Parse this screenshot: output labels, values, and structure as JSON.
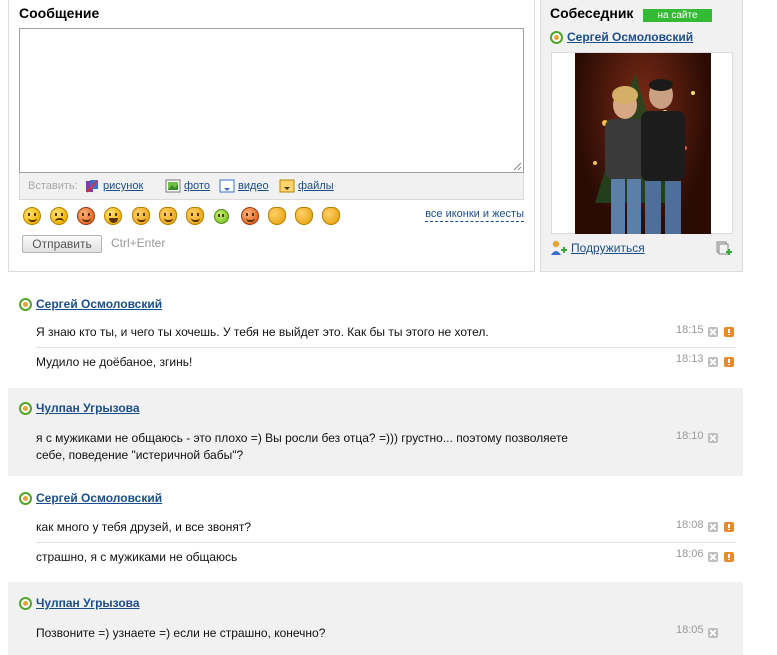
{
  "compose": {
    "title": "Сообщение",
    "insert_label": "Вставить:",
    "insert_items": [
      "рисунок",
      "фото",
      "видео",
      "файлы"
    ],
    "all_icons_label": "все иконки и жесты",
    "send_label": "Отправить",
    "hotkey": "Ctrl+Enter",
    "emoticons": [
      "smile-emoticon",
      "cry-emoticon",
      "angry-emoticon",
      "laugh-emoticon",
      "tongue-emoticon",
      "facepalm-emoticon",
      "shy-emoticon",
      "green-alien-emoticon",
      "devil-emoticon",
      "thumbs-up-emoticon",
      "victory-emoticon",
      "palm-emoticon"
    ]
  },
  "partner": {
    "title": "Собеседник",
    "status": "на сайте",
    "name": "Сергей Осмоловский",
    "befriend_label": "Подружиться"
  },
  "conversation": [
    {
      "author": "Сергей Осмоловский",
      "messages": [
        {
          "text": "Я знаю кто ты, и чего ты хочешь. У тебя не выйдет это. Как бы ты этого не хотел.",
          "time": "18:15",
          "warn": true
        },
        {
          "text": "Мудило не доёбаное, згинь!",
          "time": "18:13",
          "warn": true
        }
      ]
    },
    {
      "author": "Чулпан Угрызова",
      "messages": [
        {
          "text": "я с мужиками не общаюсь - это плохо =) Вы росли без отца? =))) грустно... поэтому позволяете себе, поведение \"истеричной бабы\"?",
          "time": "18:10",
          "warn": false
        }
      ]
    },
    {
      "author": "Сергей Осмоловский",
      "messages": [
        {
          "text": "как много у тебя друзей, и все звонят?",
          "time": "18:08",
          "warn": true
        },
        {
          "text": "страшно, я с мужиками не общаюсь",
          "time": "18:06",
          "warn": true
        }
      ]
    },
    {
      "author": "Чулпан Угрызова",
      "messages": [
        {
          "text": "Позвоните =) узнаете =) если не страшно, конечно?",
          "time": "18:05",
          "warn": false
        }
      ]
    }
  ]
}
